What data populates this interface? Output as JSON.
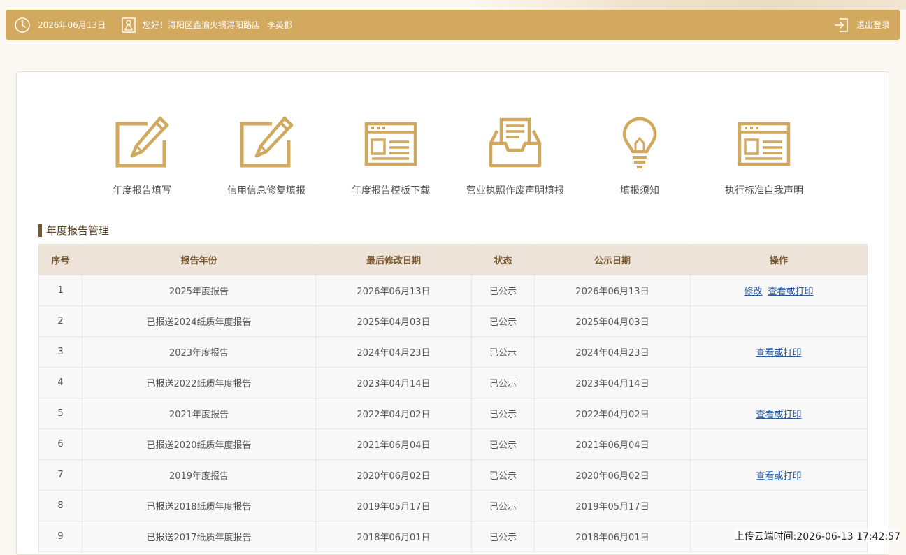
{
  "header": {
    "date": "2026年06月13日",
    "greeting": "您好！浔阳区鑫渝火锅浔阳路店",
    "user_name": "李英郡",
    "logout_label": "退出登录"
  },
  "menu": [
    {
      "label": "年度报告填写",
      "icon": "edit-icon"
    },
    {
      "label": "信用信息修复填报",
      "icon": "edit-icon"
    },
    {
      "label": "年度报告模板下载",
      "icon": "document-panel-icon"
    },
    {
      "label": "营业执照作废声明填报",
      "icon": "inbox-tray-icon"
    },
    {
      "label": "填报须知",
      "icon": "lightbulb-icon"
    },
    {
      "label": "执行标准自我声明",
      "icon": "document-panel-icon"
    }
  ],
  "section_title": "年度报告管理",
  "table": {
    "headers": [
      "序号",
      "报告年份",
      "最后修改日期",
      "状态",
      "公示日期",
      "操作"
    ],
    "rows": [
      {
        "no": "1",
        "year": "2025年度报告",
        "modified": "2026年06月13日",
        "status": "已公示",
        "public_date": "2026年06月13日",
        "actions": [
          "修改",
          "查看或打印"
        ]
      },
      {
        "no": "2",
        "year": "已报送2024纸质年度报告",
        "modified": "2025年04月03日",
        "status": "已公示",
        "public_date": "2025年04月03日",
        "actions": []
      },
      {
        "no": "3",
        "year": "2023年度报告",
        "modified": "2024年04月23日",
        "status": "已公示",
        "public_date": "2024年04月23日",
        "actions": [
          "查看或打印"
        ]
      },
      {
        "no": "4",
        "year": "已报送2022纸质年度报告",
        "modified": "2023年04月14日",
        "status": "已公示",
        "public_date": "2023年04月14日",
        "actions": []
      },
      {
        "no": "5",
        "year": "2021年度报告",
        "modified": "2022年04月02日",
        "status": "已公示",
        "public_date": "2022年04月02日",
        "actions": [
          "查看或打印"
        ]
      },
      {
        "no": "6",
        "year": "已报送2020纸质年度报告",
        "modified": "2021年06月04日",
        "status": "已公示",
        "public_date": "2021年06月04日",
        "actions": []
      },
      {
        "no": "7",
        "year": "2019年度报告",
        "modified": "2020年06月02日",
        "status": "已公示",
        "public_date": "2020年06月02日",
        "actions": [
          "查看或打印"
        ]
      },
      {
        "no": "8",
        "year": "已报送2018纸质年度报告",
        "modified": "2019年05月17日",
        "status": "已公示",
        "public_date": "2019年05月17日",
        "actions": []
      },
      {
        "no": "9",
        "year": "已报送2017纸质年度报告",
        "modified": "2018年06月01日",
        "status": "已公示",
        "public_date": "2018年06月01日",
        "actions": []
      }
    ]
  },
  "upload_time": "上传云端时间:2026-06-13 17:42:57",
  "colors": {
    "accent": "#d2a95f",
    "icon": "#d0a85e",
    "link": "#2a5aa0",
    "table_header_bg": "#ede3d8"
  }
}
